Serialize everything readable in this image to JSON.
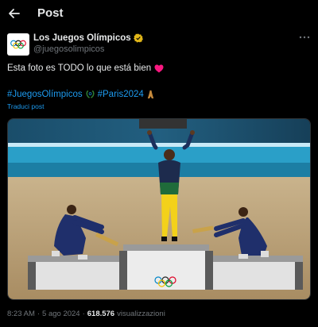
{
  "header": {
    "back_icon": "arrow-left-icon",
    "title": "Post"
  },
  "author": {
    "name": "Los Juegos Olímpicos",
    "handle": "@juegosolimpicos",
    "verified_icon": "gold-verified-badge-icon",
    "avatar_icon": "olympic-rings-icon",
    "more_icon": "more-horizontal-icon"
  },
  "post": {
    "text": "Esta foto es TODO lo que está bien",
    "emoji": "red-heart-icon",
    "hashtags": [
      "#JuegosOlímpicos",
      "#Paris2024"
    ],
    "hashtag_icons": [
      "olympic-laurel-emoji-icon",
      "eiffel-tower-emoji-icon"
    ],
    "translate_label": "Traduci post"
  },
  "media": {
    "image_icon": "podium-photo"
  },
  "meta": {
    "time": "8:23 AM",
    "separator": "·",
    "date": "5 ago 2024",
    "views_count": "618.576",
    "views_label": "visualizzazioni"
  },
  "colors": {
    "accent": "#1d9bf0",
    "background": "#000000",
    "muted": "#71767b",
    "heart": "#f91880"
  }
}
